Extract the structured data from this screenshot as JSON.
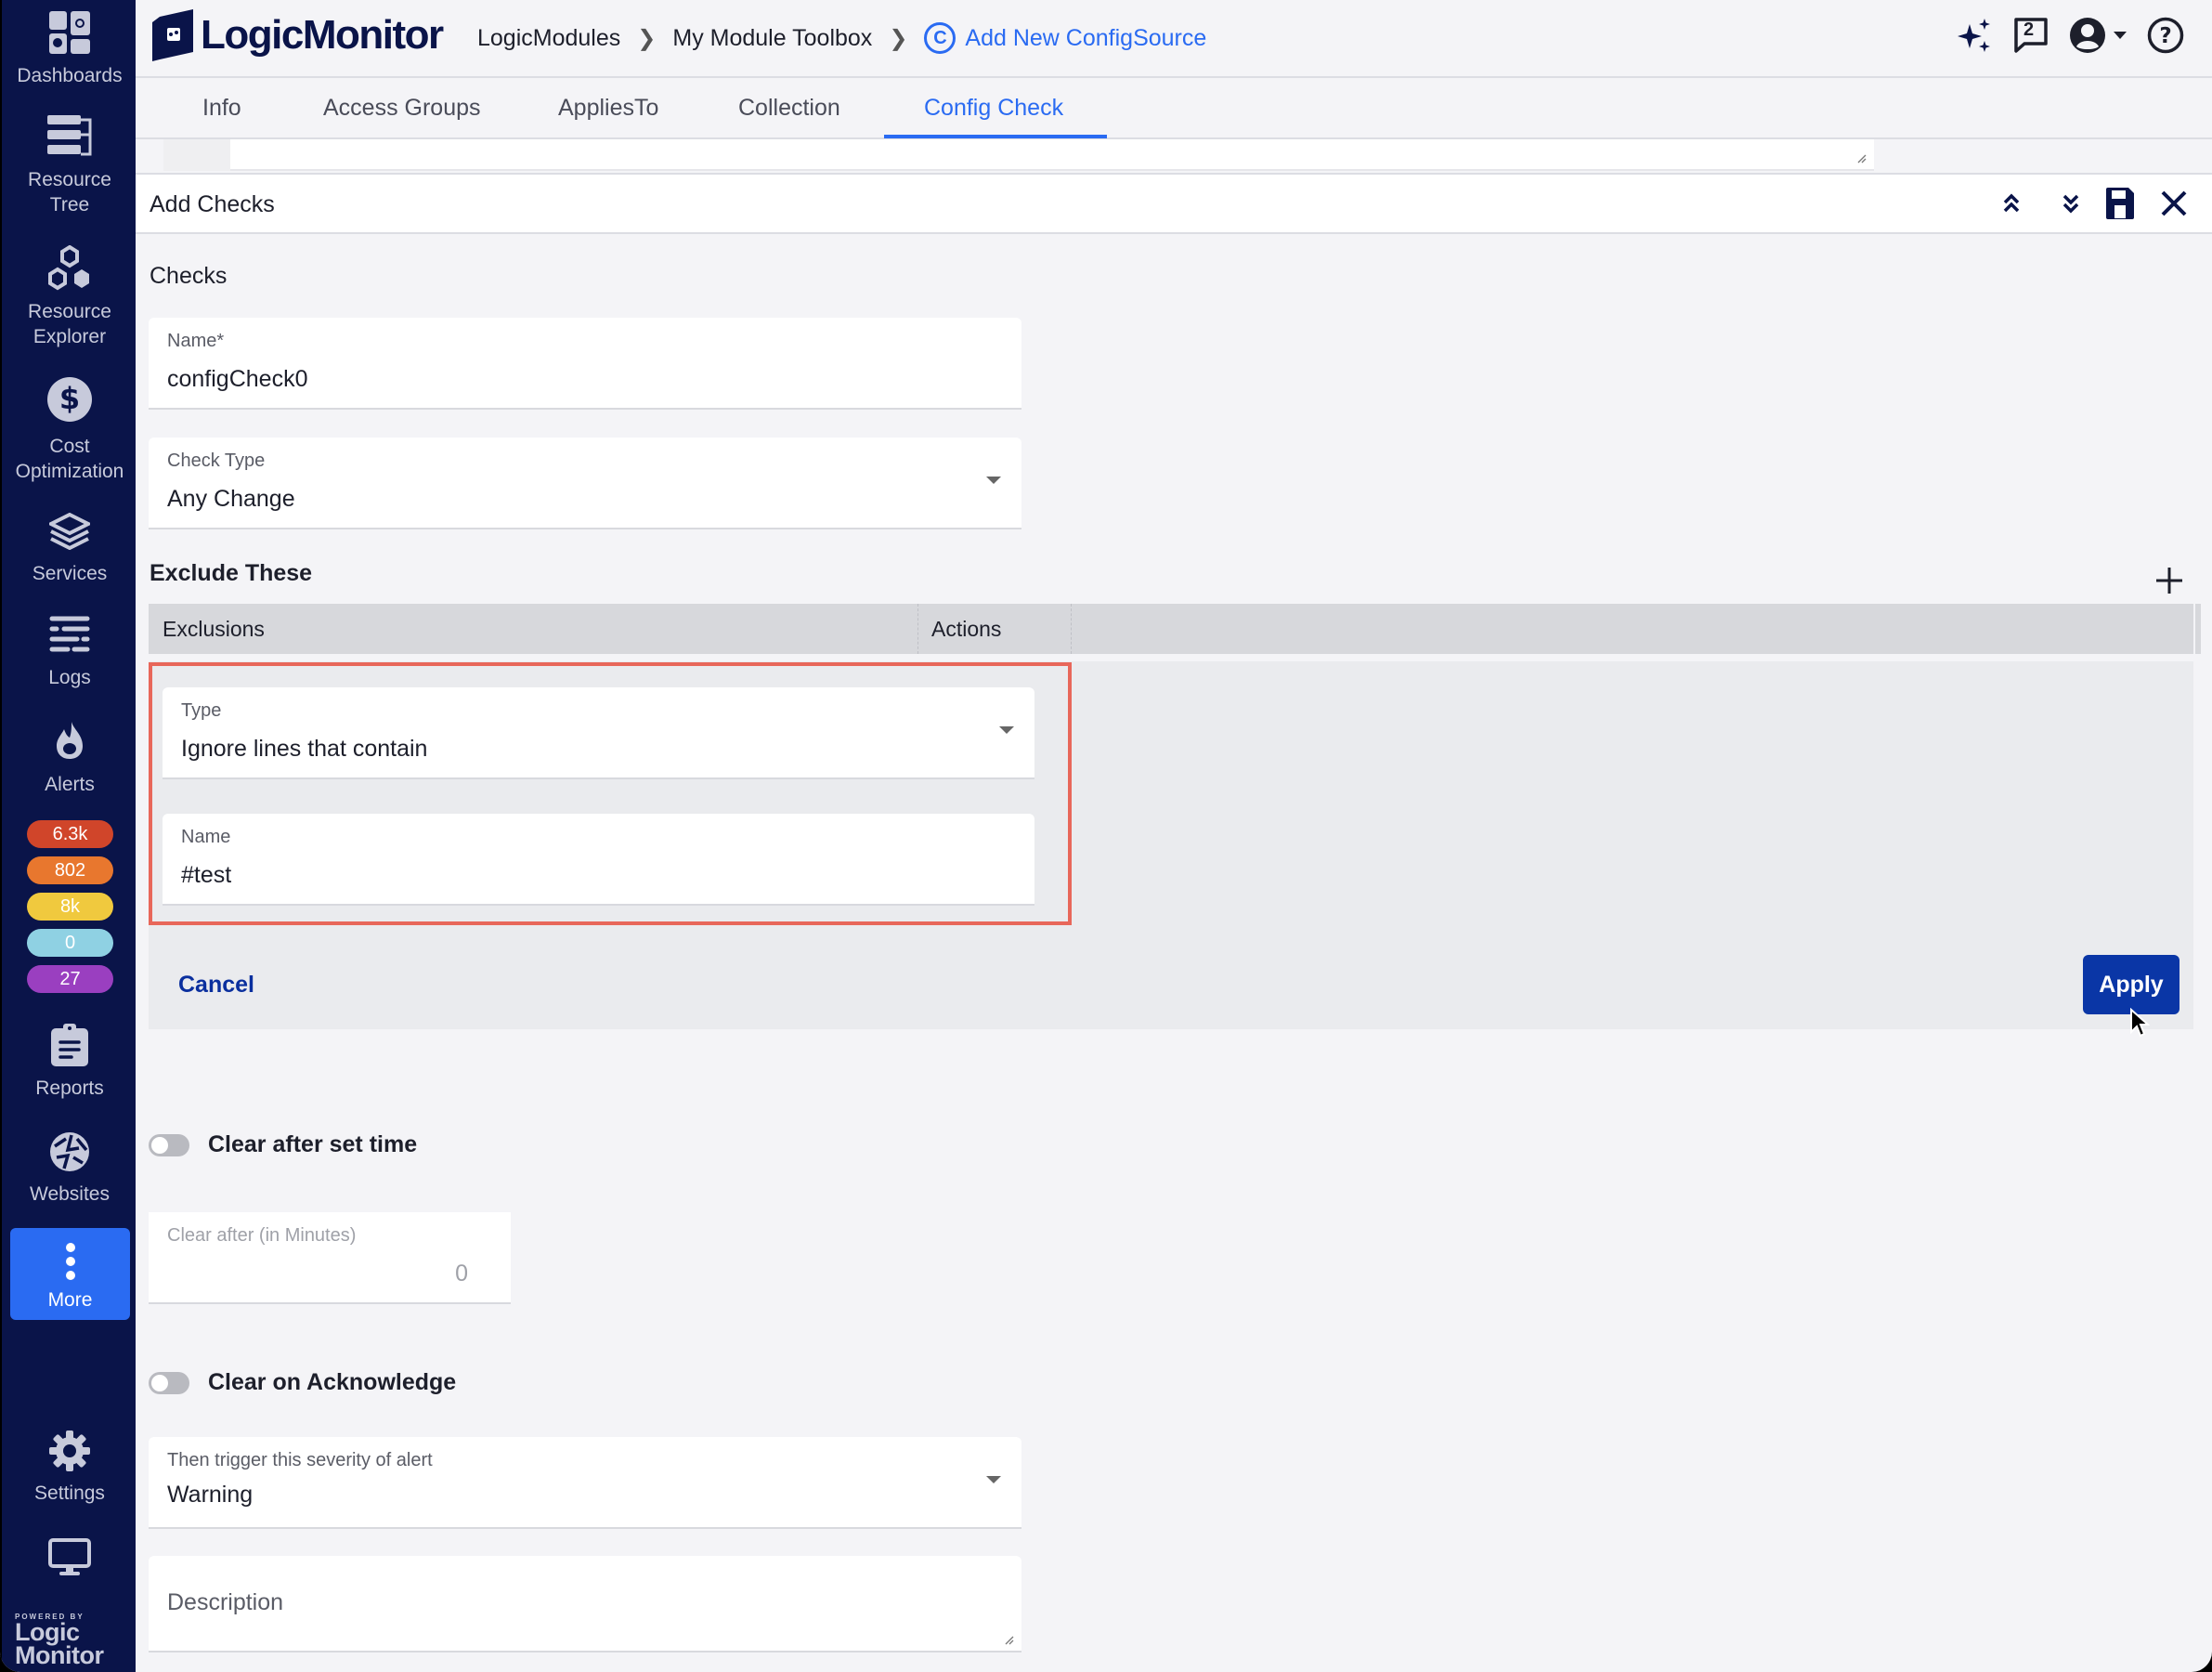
{
  "sidebar": {
    "items": [
      {
        "label": "Dashboards",
        "icon": "dashboards-icon"
      },
      {
        "label": "Resource\nTree",
        "label_line1": "Resource",
        "label_line2": "Tree",
        "icon": "resource-tree-icon"
      },
      {
        "label_line1": "Resource",
        "label_line2": "Explorer",
        "icon": "resource-explorer-icon"
      },
      {
        "label_line1": "Cost",
        "label_line2": "Optimization",
        "icon": "dollar-icon"
      },
      {
        "label": "Services",
        "icon": "layers-icon"
      },
      {
        "label": "Logs",
        "icon": "logs-icon"
      },
      {
        "label": "Alerts",
        "icon": "flame-icon"
      },
      {
        "label": "Reports",
        "icon": "clipboard-icon"
      },
      {
        "label": "Websites",
        "icon": "globe-icon"
      },
      {
        "label": "More",
        "icon": "more-vertical-icon"
      },
      {
        "label": "Settings",
        "icon": "gear-icon"
      },
      {
        "label": "",
        "icon": "monitor-icon"
      }
    ],
    "alert_badges": [
      {
        "value": "6.3k",
        "color": "#d0452a",
        "severity": "critical"
      },
      {
        "value": "802",
        "color": "#e8772e",
        "severity": "error"
      },
      {
        "value": "8k",
        "color": "#f0c93e",
        "severity": "warning"
      },
      {
        "value": "0",
        "color": "#8fd1e3",
        "severity": "info"
      },
      {
        "value": "27",
        "color": "#9a3fc0",
        "severity": "other"
      }
    ],
    "powered_by": "POWERED BY",
    "powered_logo_line1": "Logic",
    "powered_logo_line2": "Monitor"
  },
  "header": {
    "logo_text": "LogicMonitor",
    "breadcrumbs": [
      "LogicModules",
      "My Module Toolbox",
      "Add New ConfigSource"
    ],
    "current_crumb_icon": "C",
    "chat_count": "2"
  },
  "tabs": [
    {
      "label": "Info",
      "active": false
    },
    {
      "label": "Access Groups",
      "active": false
    },
    {
      "label": "AppliesTo",
      "active": false
    },
    {
      "label": "Collection",
      "active": false
    },
    {
      "label": "Config Check",
      "active": true
    }
  ],
  "panel": {
    "title": "Add Checks",
    "checks_heading": "Checks",
    "name_field": {
      "label": "Name*",
      "value": "configCheck0"
    },
    "check_type": {
      "label": "Check Type",
      "value": "Any Change"
    },
    "exclude_heading": "Exclude These",
    "table_columns": [
      "Exclusions",
      "Actions"
    ],
    "exclusion_editor": {
      "type": {
        "label": "Type",
        "value": "Ignore lines that contain"
      },
      "name": {
        "label": "Name",
        "value": "#test"
      }
    },
    "cancel_label": "Cancel",
    "apply_label": "Apply",
    "clear_after_toggle": {
      "label": "Clear after set time",
      "on": false
    },
    "clear_after_field": {
      "label": "Clear after (in Minutes)",
      "value": "0"
    },
    "clear_on_ack_toggle": {
      "label": "Clear on Acknowledge",
      "on": false
    },
    "severity": {
      "label": "Then trigger this severity of alert",
      "value": "Warning"
    },
    "description": {
      "placeholder": "Description",
      "value": ""
    }
  },
  "colors": {
    "sidebar_bg": "#0a1449",
    "accent": "#2a6bf2",
    "apply_button": "#0a36a6",
    "highlight_box": "#e8675a"
  }
}
